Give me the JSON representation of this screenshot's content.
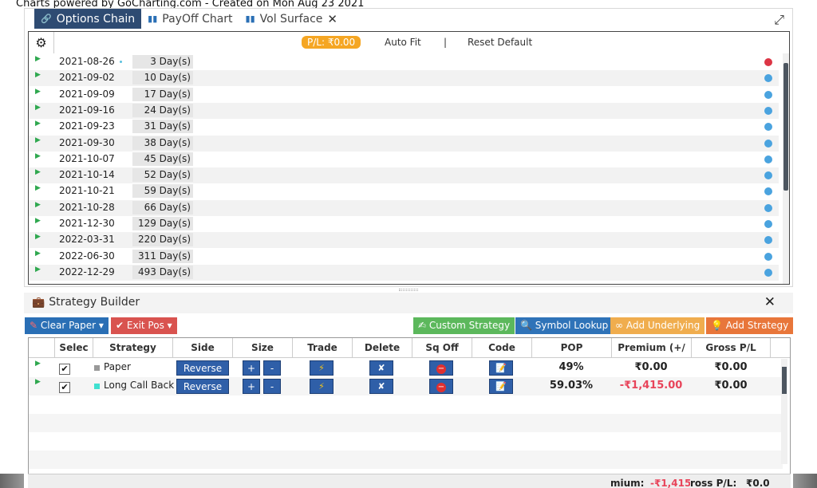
{
  "credit": "Charts powered by GoCharting.com - Created on Mon Aug 23 2021",
  "tabs": [
    {
      "label": "Options Chain",
      "icon": "link-icon"
    },
    {
      "label": "PayOff Chart",
      "icon": "bar-chart-icon"
    },
    {
      "label": "Vol Surface",
      "icon": "bar-chart-icon"
    }
  ],
  "toolbar": {
    "pl_label": "P/L: ₹0.00",
    "auto_fit": "Auto Fit",
    "separator": "|",
    "reset_default": "Reset Default"
  },
  "expiries": [
    {
      "date": "2021-08-26",
      "days": "3 Day(s)",
      "status": "red"
    },
    {
      "date": "2021-09-02",
      "days": "10 Day(s)",
      "status": "blue"
    },
    {
      "date": "2021-09-09",
      "days": "17 Day(s)",
      "status": "blue"
    },
    {
      "date": "2021-09-16",
      "days": "24 Day(s)",
      "status": "blue"
    },
    {
      "date": "2021-09-23",
      "days": "31 Day(s)",
      "status": "blue"
    },
    {
      "date": "2021-09-30",
      "days": "38 Day(s)",
      "status": "blue"
    },
    {
      "date": "2021-10-07",
      "days": "45 Day(s)",
      "status": "blue"
    },
    {
      "date": "2021-10-14",
      "days": "52 Day(s)",
      "status": "blue"
    },
    {
      "date": "2021-10-21",
      "days": "59 Day(s)",
      "status": "blue"
    },
    {
      "date": "2021-10-28",
      "days": "66 Day(s)",
      "status": "blue"
    },
    {
      "date": "2021-12-30",
      "days": "129 Day(s)",
      "status": "blue"
    },
    {
      "date": "2022-03-31",
      "days": "220 Day(s)",
      "status": "blue"
    },
    {
      "date": "2022-06-30",
      "days": "311 Day(s)",
      "status": "blue"
    },
    {
      "date": "2022-12-29",
      "days": "493 Day(s)",
      "status": "blue"
    }
  ],
  "status_colors": {
    "red": "#dc3545",
    "blue": "#4aa3df"
  },
  "strategy_builder": {
    "title": "Strategy Builder",
    "buttons": {
      "clear_paper": "Clear Paper",
      "exit_pos": "Exit Pos",
      "custom_strategy": "Custom Strategy",
      "symbol_lookup": "Symbol Lookup",
      "add_underlying": "Add Underlying",
      "add_strategy": "Add Strategy"
    },
    "columns": [
      "Selec",
      "Strategy",
      "Side",
      "Size",
      "Trade",
      "Delete",
      "Sq Off",
      "Code",
      "POP",
      "Premium (+/",
      "Gross P/L"
    ],
    "rows": [
      {
        "name": "Paper",
        "swatch": "#999999",
        "side": "Reverse",
        "plus": "+",
        "minus": "-",
        "pop": "49%",
        "premium": "₹0.00",
        "premium_color": "#222222",
        "gross": "₹0.00"
      },
      {
        "name": "Long Call Back",
        "swatch": "#40e0d0",
        "side": "Reverse",
        "plus": "+",
        "minus": "-",
        "pop": "59.03%",
        "premium": "-₹1,415.00",
        "premium_color": "#e8445a",
        "gross": "₹0.00"
      }
    ],
    "footer": {
      "premium_label": "mium:",
      "premium_value": "-₹1,415",
      "gross_label": "ross P/L:",
      "gross_value": "₹0.0"
    }
  }
}
